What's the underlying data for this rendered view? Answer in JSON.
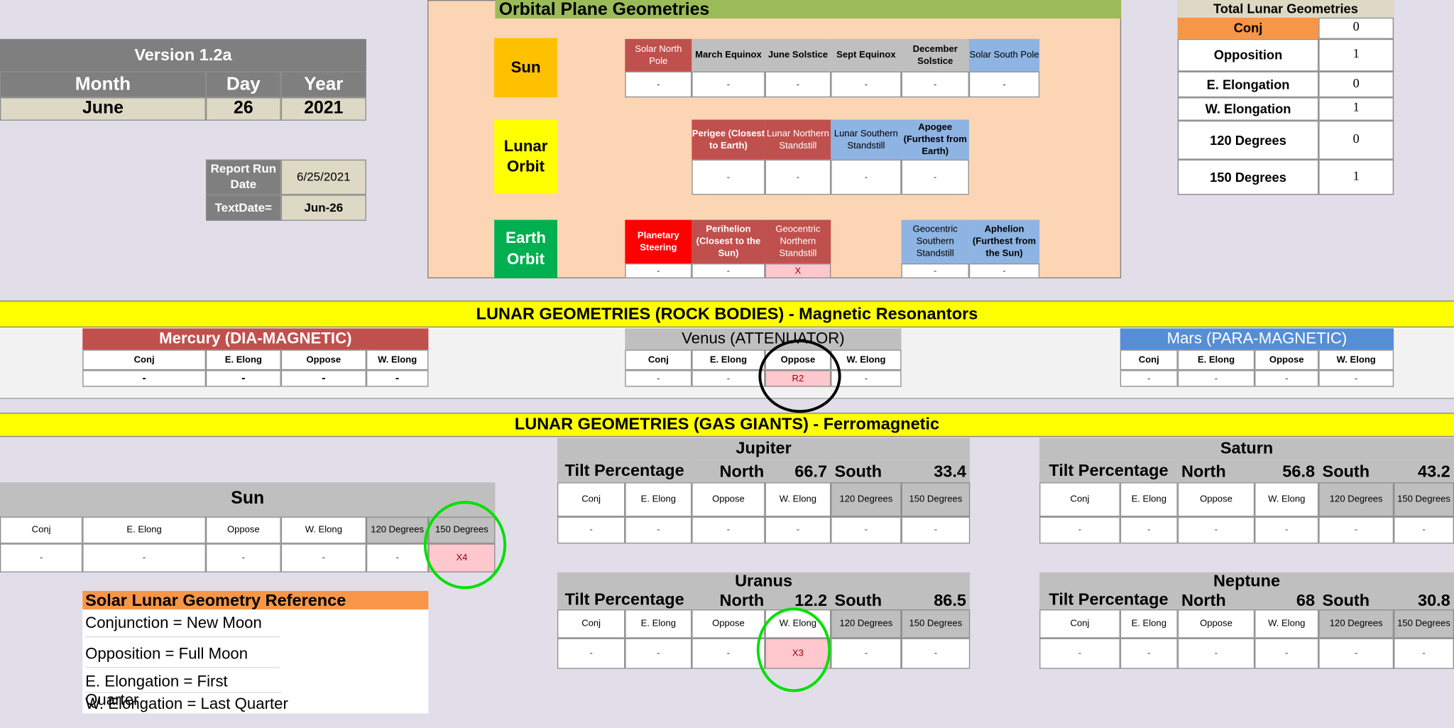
{
  "header": {
    "version": "Version 1.2a",
    "month_label": "Month",
    "day_label": "Day",
    "year_label": "Year",
    "month": "June",
    "day": "26",
    "year": "2021",
    "report_run_label": "Report Run Date",
    "report_run_value": "6/25/2021",
    "textdate_label": "TextDate=",
    "textdate_value": "Jun-26"
  },
  "orbital": {
    "title": "Orbital Plane Geometries",
    "sun_label": "Sun",
    "sun_cols": [
      "Solar North Pole",
      "March Equinox",
      "June Solstice",
      "Sept Equinox",
      "December Solstice",
      "Solar South Pole"
    ],
    "sun_vals": [
      "-",
      "-",
      "-",
      "-",
      "-",
      "-"
    ],
    "lunar_label": "Lunar Orbit",
    "lunar_cols": [
      "Perigee (Closest to Earth)",
      "Lunar Northern Standstill",
      "Lunar Southern Standstill",
      "Apogee (Furthest from Earth)"
    ],
    "lunar_vals": [
      "-",
      "-",
      "-",
      "-"
    ],
    "earth_label": "Earth Orbit",
    "earth_cols": [
      "Planetary Steering",
      "Perihelion (Closest to the Sun)",
      "Geocentric Northern Standstill",
      "Geocentric Southern Standstill",
      "Aphelion (Furthest from the Sun)"
    ],
    "earth_vals": [
      "-",
      "-",
      "X",
      "-",
      "-"
    ]
  },
  "totals": {
    "title": "Total Lunar Geometries",
    "rows": [
      {
        "label": "Conj",
        "value": "0"
      },
      {
        "label": "Opposition",
        "value": "1"
      },
      {
        "label": "E. Elongation",
        "value": "0"
      },
      {
        "label": "W. Elongation",
        "value": "1"
      },
      {
        "label": "120 Degrees",
        "value": "0"
      },
      {
        "label": "150 Degrees",
        "value": "1"
      }
    ]
  },
  "rock": {
    "banner": "LUNAR GEOMETRIES (ROCK BODIES) - Magnetic Resonantors",
    "cols": [
      "Conj",
      "E. Elong",
      "Oppose",
      "W. Elong"
    ],
    "mercury": {
      "title": "Mercury (DIA-MAGNETIC)",
      "vals": [
        "-",
        "-",
        "-",
        "-"
      ]
    },
    "venus": {
      "title": "Venus (ATTENUATOR)",
      "vals": [
        "-",
        "-",
        "R2",
        "-"
      ]
    },
    "mars": {
      "title": "Mars (PARA-MAGNETIC)",
      "vals": [
        "-",
        "-",
        "-",
        "-"
      ]
    }
  },
  "gas": {
    "banner": "LUNAR GEOMETRIES (GAS GIANTS) - Ferromagnetic",
    "cols": [
      "Conj",
      "E. Elong",
      "Oppose",
      "W. Elong",
      "120 Degrees",
      "150 Degrees"
    ],
    "tilt_label": "Tilt Percentage",
    "north_label": "North",
    "south_label": "South",
    "sun": {
      "title": "Sun",
      "vals": [
        "-",
        "-",
        "-",
        "-",
        "-",
        "X4"
      ]
    },
    "jupiter": {
      "title": "Jupiter",
      "north": "66.7",
      "south": "33.4",
      "vals": [
        "-",
        "-",
        "-",
        "-",
        "-",
        "-"
      ]
    },
    "saturn": {
      "title": "Saturn",
      "north": "56.8",
      "south": "43.2",
      "vals": [
        "-",
        "-",
        "-",
        "-",
        "-",
        "-"
      ]
    },
    "uranus": {
      "title": "Uranus",
      "north": "12.2",
      "south": "86.5",
      "vals": [
        "-",
        "-",
        "-",
        "X3",
        "-",
        "-"
      ]
    },
    "neptune": {
      "title": "Neptune",
      "north": "68",
      "south": "30.8",
      "vals": [
        "-",
        "-",
        "-",
        "-",
        "-",
        "-"
      ]
    }
  },
  "reference": {
    "title": "Solar Lunar Geometry Reference",
    "lines": [
      "Conjunction = New Moon",
      "Opposition = Full Moon",
      "E. Elongation = First Quarter",
      "W. Elongation = Last Quarter"
    ]
  },
  "colors": {
    "banner_yellow": "#ffff00",
    "orbital_bg": "#fcd5b4",
    "highlight_pink": "#ffc7ce",
    "green_ring": "#00e000",
    "black_ring": "#000000"
  }
}
